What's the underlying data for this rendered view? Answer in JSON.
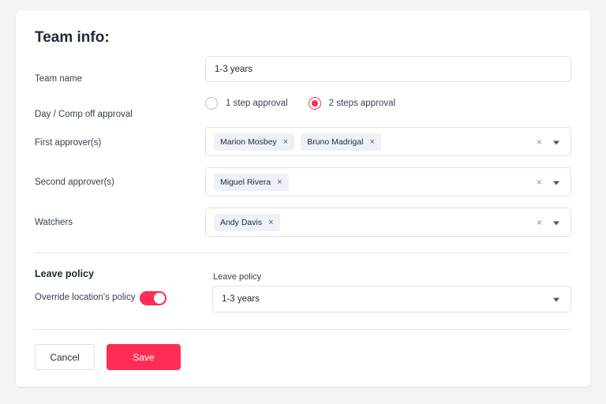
{
  "title": "Team info:",
  "team_name": {
    "label": "Team name",
    "value": "1-3 years"
  },
  "approval": {
    "label": "Day / Comp off approval",
    "options": [
      {
        "label": "1 step approval",
        "checked": false
      },
      {
        "label": "2 steps approval",
        "checked": true
      }
    ]
  },
  "first_approvers": {
    "label": "First approver(s)",
    "chips": [
      "Marion Mosbey",
      "Bruno Madrigal"
    ]
  },
  "second_approvers": {
    "label": "Second approver(s)",
    "chips": [
      "Miguel Rivera"
    ]
  },
  "watchers": {
    "label": "Watchers",
    "chips": [
      "Andy Davis"
    ]
  },
  "icons": {
    "chip_remove": "×",
    "clear": "×"
  },
  "leave_policy": {
    "section_title": "Leave policy",
    "override_label": "Override location's policy",
    "override_enabled": true,
    "select_label": "Leave policy",
    "select_value": "1-3 years"
  },
  "buttons": {
    "cancel": "Cancel",
    "save": "Save"
  },
  "colors": {
    "accent": "#ff2d55",
    "chip_bg": "#eef1f7",
    "border": "#dfe3e8"
  }
}
